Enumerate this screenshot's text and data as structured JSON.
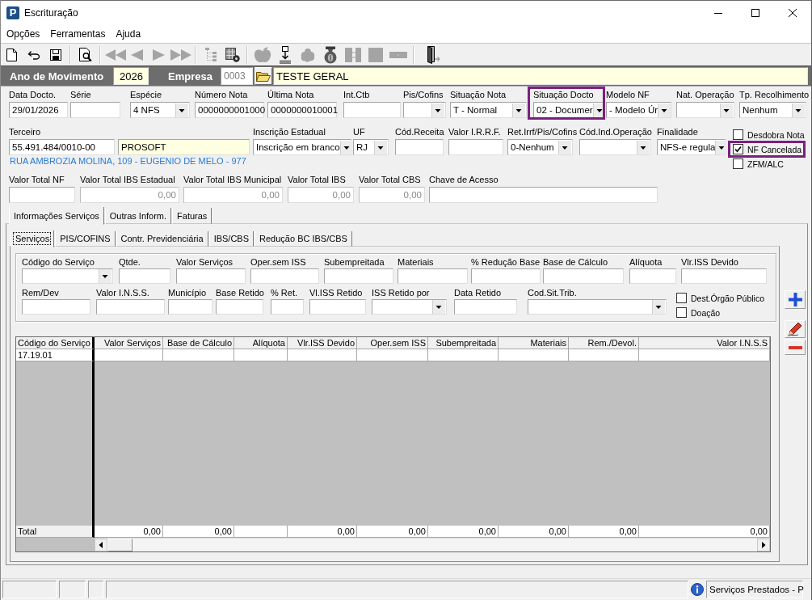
{
  "window": {
    "title": "Escrituração",
    "icon_text": "P"
  },
  "menu": [
    "Opções",
    "Ferramentas",
    "Ajuda"
  ],
  "header": {
    "year_label": "Ano de Movimento",
    "year": "2026",
    "company_label": "Empresa",
    "company_code": "0003",
    "company_code_disabled": true,
    "company_name": "TESTE GERAL"
  },
  "document_fields": [
    {
      "label": "Data Docto.",
      "kind": "input",
      "value": "29/01/2026",
      "highlighted": false
    },
    {
      "label": "Série",
      "kind": "input",
      "highlighted": false
    },
    {
      "label": "Espécie",
      "kind": "select",
      "value": "4 NFS",
      "highlighted": false
    },
    {
      "label": "Número Nota",
      "kind": "input",
      "value": "0000000001000",
      "highlighted": false
    },
    {
      "label": "Última Nota",
      "kind": "input",
      "value": "0000000010001",
      "highlighted": false
    },
    {
      "label": "Int.Ctb",
      "kind": "input",
      "highlighted": false
    },
    {
      "label": "Pis/Cofins",
      "kind": "select",
      "highlighted": false
    },
    {
      "label": "Situação Nota",
      "kind": "select",
      "value": "T - Normal",
      "highlighted": false
    },
    {
      "label": "Situação Docto",
      "kind": "select",
      "value": "02 - Documer",
      "highlighted": true
    },
    {
      "label": "Modelo NF",
      "kind": "select",
      "value": "- Modelo Úr",
      "highlighted": false
    },
    {
      "label": "Nat. Operação",
      "kind": "select",
      "highlighted": false
    },
    {
      "label": "Tp. Recolhimento",
      "kind": "select",
      "value": "Nenhum",
      "highlighted": false
    }
  ],
  "party_fields": [
    {
      "label": "Terceiro",
      "kind": "input",
      "value": "55.491.484/0010-00"
    },
    {
      "kind": "display",
      "value": "PROSOFT"
    },
    {
      "label": "Inscrição Estadual",
      "kind": "select",
      "value": "Inscrição em branco"
    },
    {
      "label": "UF",
      "kind": "select",
      "value": "RJ"
    },
    {
      "label": "Cód.Receita",
      "kind": "input"
    },
    {
      "label": "Valor I.R.R.F.",
      "kind": "input"
    },
    {
      "label": "Ret.Irrf/Pis/Cofins",
      "kind": "select",
      "value": "0-Nenhum"
    },
    {
      "label": "Cód.Ind.Operação",
      "kind": "select"
    },
    {
      "label": "Finalidade",
      "kind": "select",
      "value": "NFS-e regula"
    }
  ],
  "address": "RUA AMBROZIA MOLINA, 109 - EUGENIO DE MELO - 977",
  "totals": [
    {
      "label": "Valor Total NF",
      "disabled": false
    },
    {
      "label": "Valor Total IBS Estadual",
      "value": "0,00",
      "disabled": true
    },
    {
      "label": "Valor Total IBS Municipal",
      "value": "0,00",
      "disabled": true
    },
    {
      "label": "Valor Total IBS",
      "value": "0,00",
      "disabled": true
    },
    {
      "label": "Valor Total CBS",
      "value": "0,00",
      "disabled": true
    },
    {
      "label": "Chave de Acesso",
      "disabled": false
    }
  ],
  "options": [
    {
      "label": "Desdobra Nota",
      "checked": false,
      "highlighted": false
    },
    {
      "label": "NF Cancelada",
      "checked": true,
      "highlighted": true
    },
    {
      "label": "ZFM/ALC",
      "checked": false,
      "highlighted": false
    }
  ],
  "tabs": [
    {
      "label": "Informações Serviços",
      "selected": true
    },
    {
      "label": "Outras Inform.",
      "selected": false
    },
    {
      "label": "Faturas",
      "selected": false
    }
  ],
  "subtabs": [
    {
      "label": "Serviços",
      "selected": true
    },
    {
      "label": "PIS/COFINS",
      "selected": false
    },
    {
      "label": "Contr. Previdenciária",
      "selected": false
    },
    {
      "label": "IBS/CBS",
      "selected": false
    },
    {
      "label": "Redução BC IBS/CBS",
      "selected": false
    }
  ],
  "service_form": {
    "upper_fields": [
      {
        "label": "Código do Serviço",
        "kind": "select"
      },
      {
        "label": "Qtde.",
        "kind": "input"
      },
      {
        "label": "Valor Serviços",
        "kind": "input"
      },
      {
        "label": "Oper.sem ISS",
        "kind": "input"
      },
      {
        "label": "Subempreitada",
        "kind": "input"
      },
      {
        "label": "Materiais",
        "kind": "input"
      },
      {
        "label": "% Redução Base",
        "kind": "input"
      },
      {
        "label": "Base de Cálculo",
        "kind": "input"
      },
      {
        "label": "Alíquota",
        "kind": "input"
      },
      {
        "label": "Vlr.ISS Devido",
        "kind": "input"
      }
    ],
    "lower_fields": [
      {
        "label": "Rem/Dev",
        "kind": "input"
      },
      {
        "label": "Valor I.N.S.S.",
        "kind": "input"
      },
      {
        "label": "Município",
        "kind": "input"
      },
      {
        "label": "Base Retido",
        "kind": "input"
      },
      {
        "label": "% Ret.",
        "kind": "input"
      },
      {
        "label": "Vl.ISS Retido",
        "kind": "input"
      },
      {
        "label": "ISS Retido por",
        "kind": "select"
      },
      {
        "label": "Data Retido",
        "kind": "input"
      },
      {
        "label": "Cod.Sit.Trib.",
        "kind": "select"
      }
    ],
    "options": [
      {
        "label": "Dest.Órgão Público",
        "checked": false
      },
      {
        "label": "Doação",
        "checked": false
      }
    ]
  },
  "grid": {
    "columns": [
      "Código do Serviço",
      "Valor Serviços",
      "Base de Cálculo",
      "Alíquota",
      "Vlr.ISS Devido",
      "Oper.sem ISS",
      "Subempreitada",
      "Materiais",
      "Rem./Devol.",
      "Valor I.N.S.S"
    ],
    "rows": [
      {
        "cells": [
          "17.19.01"
        ]
      }
    ],
    "total_row": {
      "cells": [
        "Total",
        "0,00",
        "0,00",
        "",
        "0,00",
        "0,00",
        "0,00",
        "0,00",
        "0,00",
        "0,00"
      ]
    }
  },
  "status_bar": {
    "text": "Serviços Prestados - P"
  }
}
